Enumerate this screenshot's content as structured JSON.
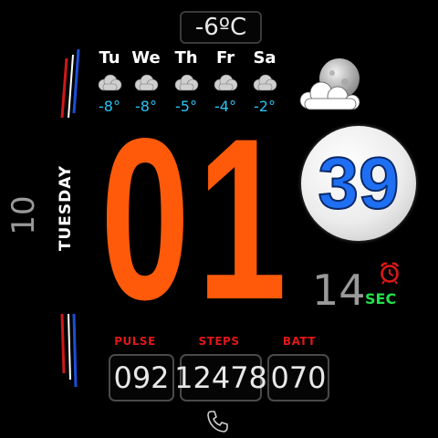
{
  "weather": {
    "current_temp": "-6ºC",
    "forecast": [
      {
        "day": "Tu",
        "temp": "-8°",
        "icon": "cloud-icon"
      },
      {
        "day": "We",
        "temp": "-8°",
        "icon": "cloud-icon"
      },
      {
        "day": "Th",
        "temp": "-5°",
        "icon": "cloud-icon"
      },
      {
        "day": "Fr",
        "temp": "-4°",
        "icon": "cloud-icon"
      },
      {
        "day": "Sa",
        "temp": "-2°",
        "icon": "cloud-icon"
      }
    ],
    "condition_icon": "moon-cloud-icon"
  },
  "date": {
    "day_number": "10",
    "day_name": "TUESDAY"
  },
  "time": {
    "hour": "01",
    "minute": "39",
    "seconds": "14",
    "seconds_label": "SEC"
  },
  "stats": {
    "pulse_label": "PULSE",
    "pulse_value": "092",
    "steps_label": "STEPS",
    "steps_value": "12478",
    "batt_label": "BATT",
    "batt_value": "070"
  },
  "colors": {
    "hour": "#ff5a0a",
    "minute": "#1f6ff2",
    "forecast_temp": "#29c5f6",
    "sec_label": "#22e04a",
    "stat_label": "#e01818"
  },
  "icons": {
    "alarm": "alarm-clock-icon",
    "phone": "phone-icon"
  }
}
